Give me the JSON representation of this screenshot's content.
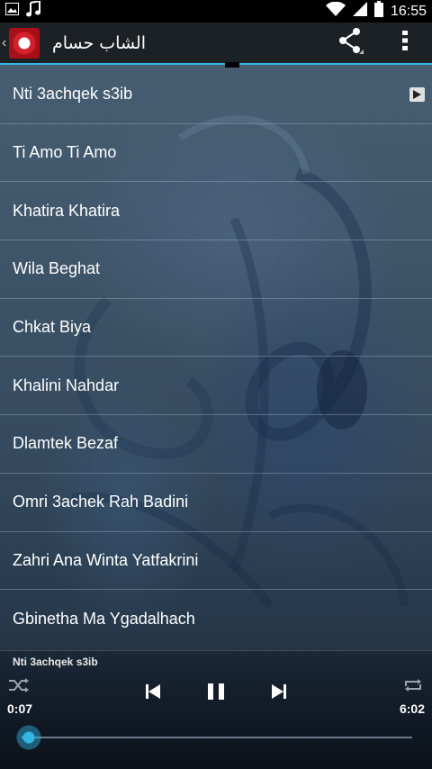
{
  "status_bar": {
    "time": "16:55",
    "icons": [
      "image-icon",
      "music-note-icon",
      "wifi-icon",
      "signal-icon",
      "battery-icon"
    ]
  },
  "action_bar": {
    "title": "الشاب حسام",
    "icons": [
      "share-icon",
      "overflow-menu-icon"
    ]
  },
  "songs": [
    {
      "title": "Nti 3achqek s3ib",
      "playing": true
    },
    {
      "title": "Ti Amo Ti Amo"
    },
    {
      "title": "Khatira Khatira"
    },
    {
      "title": "Wila Beghat"
    },
    {
      "title": "Chkat Biya"
    },
    {
      "title": "Khalini Nahdar"
    },
    {
      "title": "Dlamtek Bezaf"
    },
    {
      "title": "Omri 3achek Rah Badini"
    },
    {
      "title": "Zahri Ana Winta Yatfakrini"
    },
    {
      "title": "Gbinetha Ma Ygadalhach"
    }
  ],
  "player": {
    "now_playing": "Nti 3achqek s3ib",
    "elapsed": "0:07",
    "total": "6:02",
    "progress_fraction": 0.019,
    "controls": [
      "shuffle-icon",
      "previous-icon",
      "pause-icon",
      "next-icon",
      "repeat-icon"
    ]
  },
  "colors": {
    "accent": "#33b5e5",
    "action_bar": "#1c2126",
    "status_bar": "#000000"
  }
}
